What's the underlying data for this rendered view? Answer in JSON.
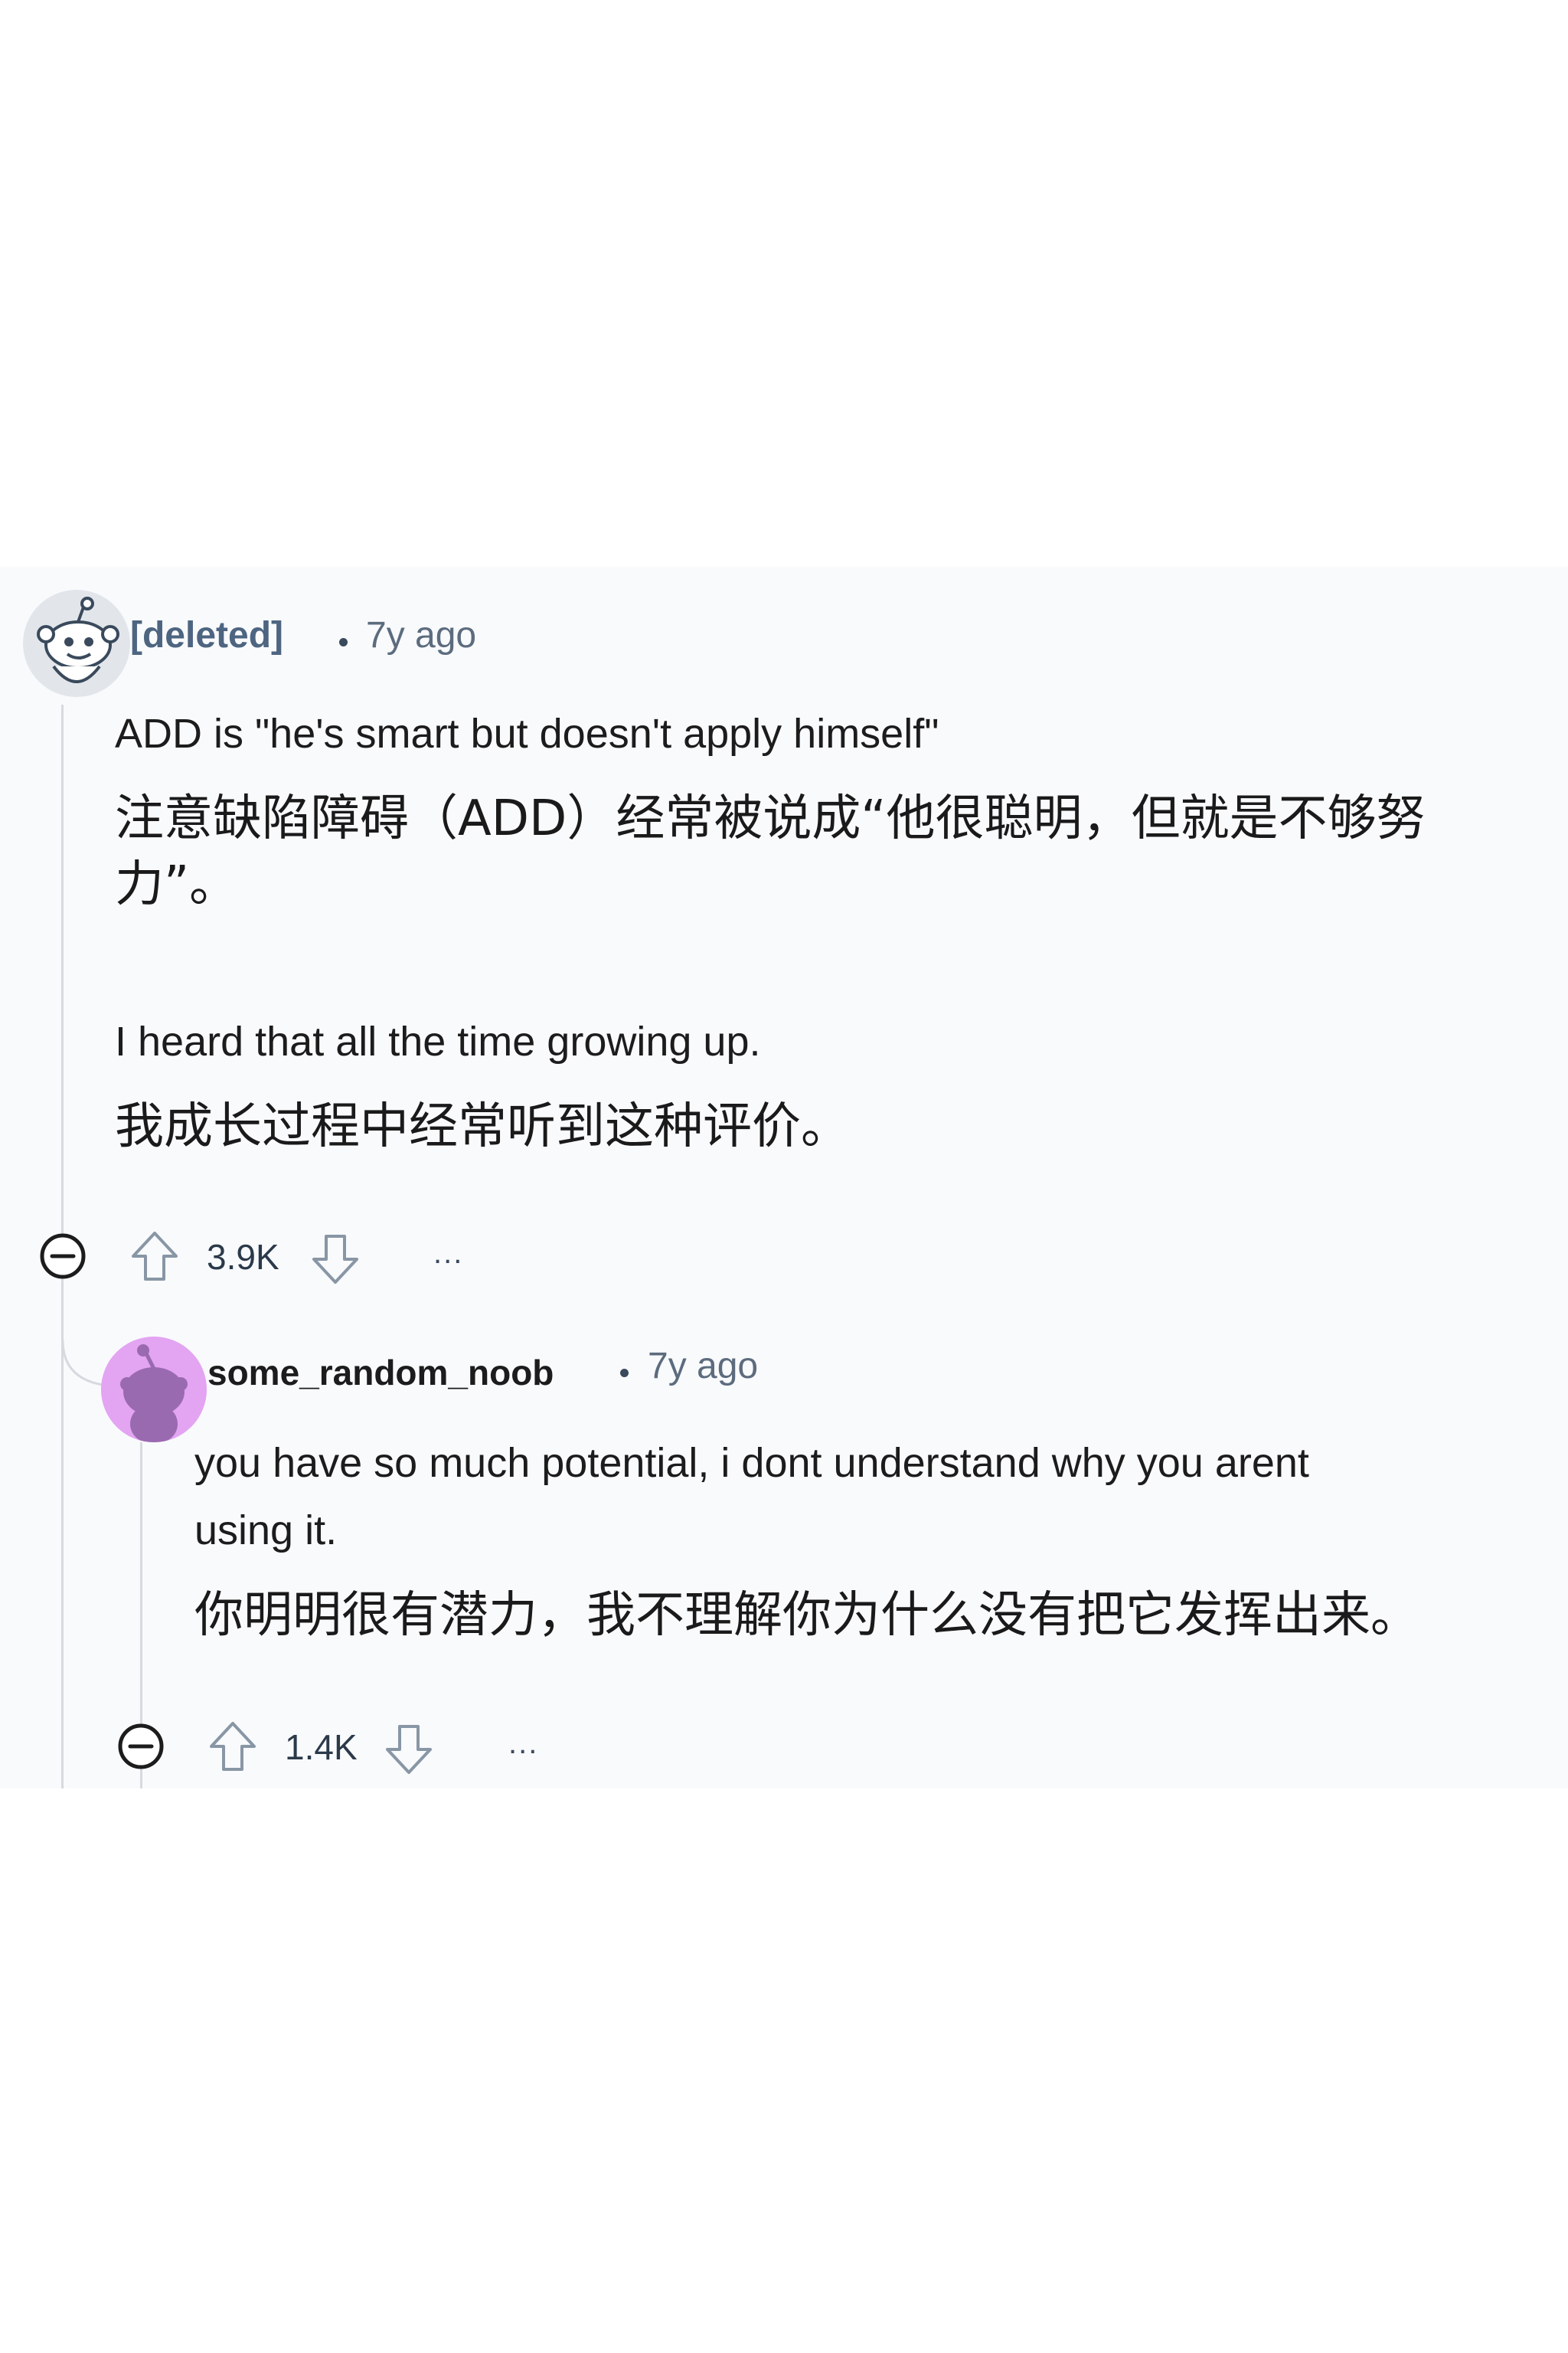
{
  "comments": [
    {
      "username": "[deleted]",
      "time": "7y ago",
      "body_en_1": "ADD is \"he's smart but doesn't apply himself\"",
      "body_zh_1": "注意缺陷障碍（ADD）经常被说成“他很聪明，但就是不够努力”。",
      "body_en_2": "I heard that all the time growing up.",
      "body_zh_2": "我成长过程中经常听到这种评价。",
      "vote_count": "3.9K",
      "more_label": "..."
    },
    {
      "username": "some_random_noob",
      "time": "7y ago",
      "body_en_1": "you have so much potential, i dont understand why you arent",
      "body_en_1b": "using it.",
      "body_zh_1": "你明明很有潜力，我不理解你为什么没有把它发挥出来。",
      "vote_count": "1.4K",
      "more_label": "..."
    }
  ],
  "icons": {
    "collapse": "collapse-minus-icon",
    "upvote": "upvote-arrow-icon",
    "downvote": "downvote-arrow-icon",
    "avatar_default": "snoo-avatar-icon"
  },
  "colors": {
    "panel_bg": "#f9fafc",
    "deleted_username": "#4d6580",
    "avatar_purple": "#e3a4f2",
    "avatar_purple_dark": "#9a6ab0",
    "thread_line": "#d6dadf"
  }
}
